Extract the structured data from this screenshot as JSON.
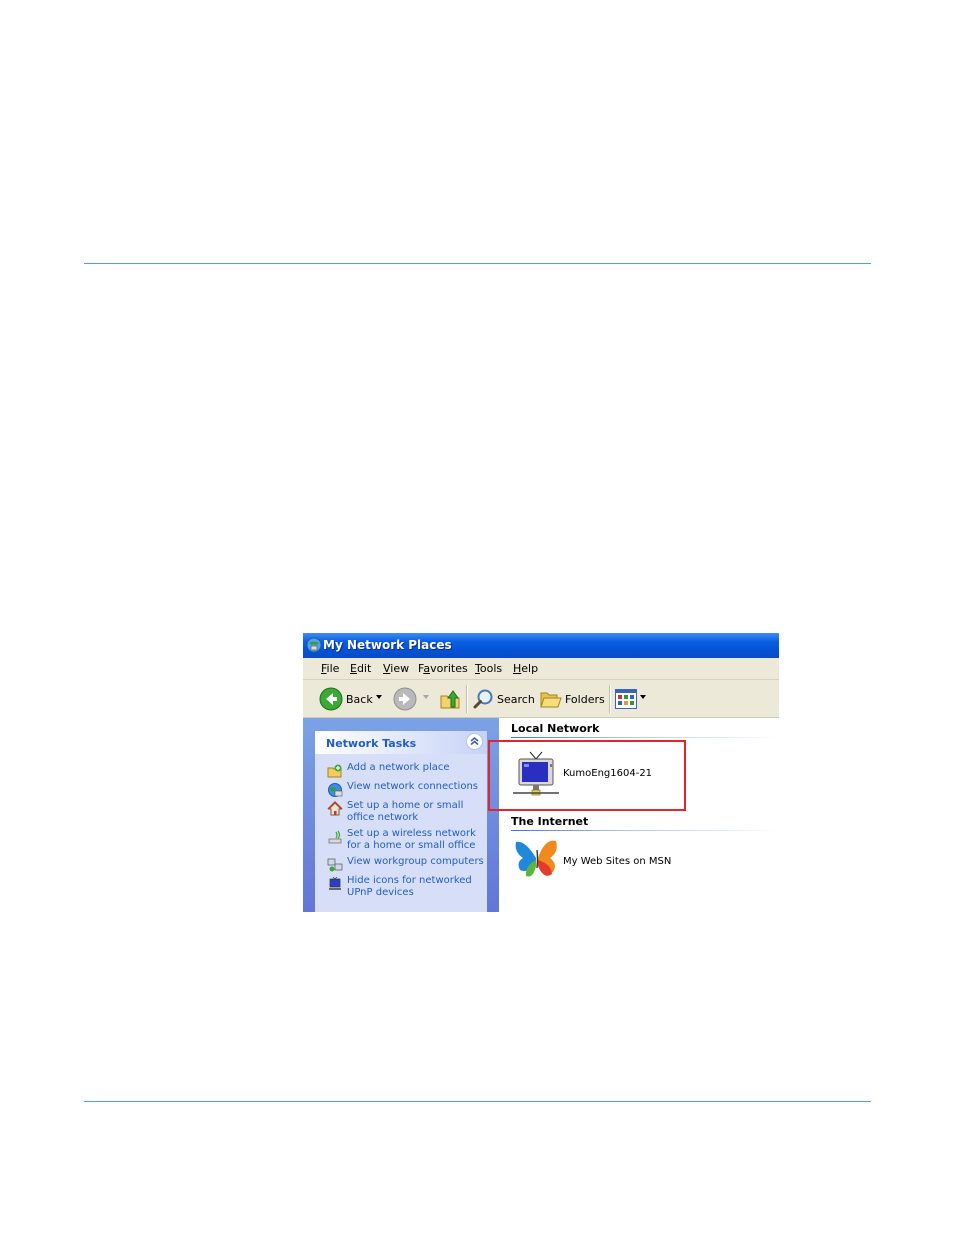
{
  "window": {
    "title": "My Network Places",
    "menu": [
      {
        "label": "File",
        "accel": "F",
        "rest": "ile"
      },
      {
        "label": "Edit",
        "accel": "E",
        "rest": "dit"
      },
      {
        "label": "View",
        "accel": "V",
        "rest": "iew"
      },
      {
        "label": "Favorites",
        "accel": "a",
        "pre": "F",
        "rest": "vorites"
      },
      {
        "label": "Tools",
        "accel": "T",
        "rest": "ools"
      },
      {
        "label": "Help",
        "accel": "H",
        "rest": "elp"
      }
    ],
    "toolbar": {
      "back_label": "Back",
      "search_label": "Search",
      "folders_label": "Folders"
    }
  },
  "side_panel": {
    "title": "Network Tasks",
    "tasks": [
      {
        "label": "Add a network place",
        "icon": "add-network-place-icon"
      },
      {
        "label": "View network connections",
        "icon": "network-connections-icon"
      },
      {
        "label": "Set up a home or small office network",
        "icon": "home-network-icon"
      },
      {
        "label": "Set up a wireless network for a home or small office",
        "icon": "wireless-network-icon"
      },
      {
        "label": "View workgroup computers",
        "icon": "workgroup-icon"
      },
      {
        "label": "Hide icons for networked UPnP devices",
        "icon": "upnp-device-icon"
      }
    ]
  },
  "groups": [
    {
      "title": "Local Network",
      "items": [
        {
          "label": "KumoEng1604-21",
          "icon": "network-device-icon"
        }
      ]
    },
    {
      "title": "The Internet",
      "items": [
        {
          "label": "My Web Sites on MSN",
          "icon": "msn-butterfly-icon"
        }
      ]
    }
  ],
  "colors": {
    "titlebar": "#0a5fe0",
    "link": "#215dc6",
    "highlight": "#e8232b",
    "rule": "#4aa7c8"
  }
}
